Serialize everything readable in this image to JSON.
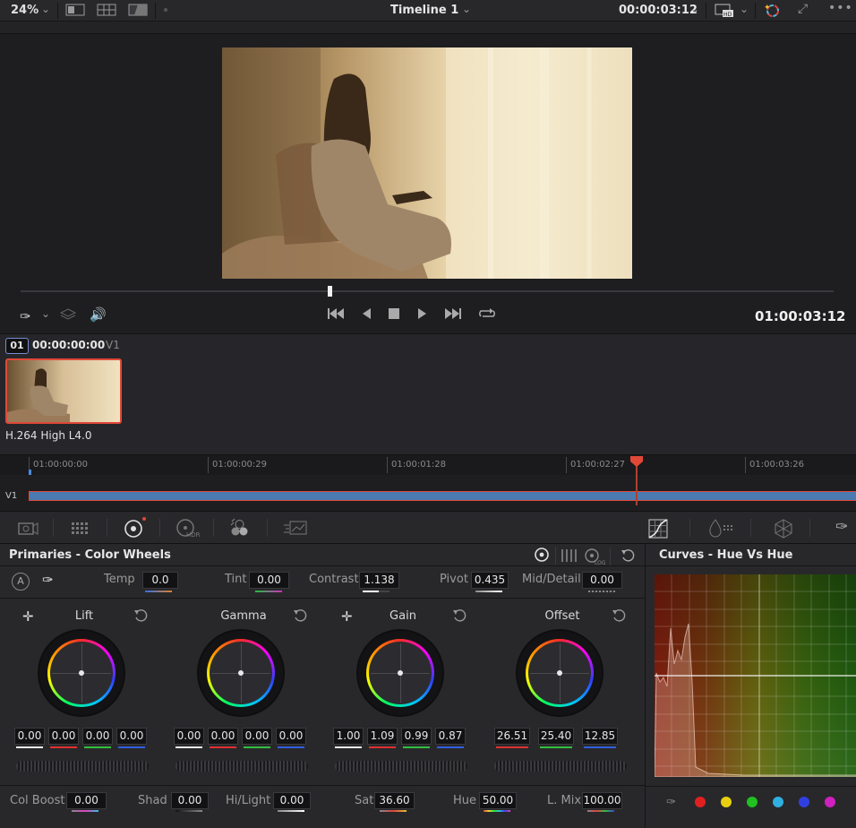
{
  "topbar": {
    "zoom": "24%",
    "timeline_name": "Timeline 1",
    "timecode": "00:00:03:12"
  },
  "viewer": {
    "timecode": "01:00:03:12"
  },
  "clip": {
    "index": "01",
    "timecode": "00:00:00:00",
    "track": "V1",
    "codec": "H.264 High L4.0"
  },
  "timeline": {
    "ticks": [
      "01:00:00:00",
      "01:00:00:29",
      "01:00:01:28",
      "01:00:02:27",
      "01:00:03:26"
    ],
    "track": "V1",
    "playhead_fraction": 0.744
  },
  "primaries": {
    "title": "Primaries - Color Wheels",
    "temp_label": "Temp",
    "temp": "0.0",
    "tint_label": "Tint",
    "tint": "0.00",
    "contrast_label": "Contrast",
    "contrast": "1.138",
    "pivot_label": "Pivot",
    "pivot": "0.435",
    "middetail_label": "Mid/Detail",
    "middetail": "0.00",
    "wheels": [
      {
        "name": "Lift",
        "values": [
          "0.00",
          "0.00",
          "0.00",
          "0.00"
        ]
      },
      {
        "name": "Gamma",
        "values": [
          "0.00",
          "0.00",
          "0.00",
          "0.00"
        ]
      },
      {
        "name": "Gain",
        "values": [
          "1.00",
          "1.09",
          "0.99",
          "0.87"
        ]
      },
      {
        "name": "Offset",
        "values": [
          "26.51",
          "25.40",
          "12.85"
        ]
      }
    ],
    "colboost_label": "Col Boost",
    "colboost": "0.00",
    "shad_label": "Shad",
    "shad": "0.00",
    "hilight_label": "Hi/Light",
    "hilight": "0.00",
    "sat_label": "Sat",
    "sat": "36.60",
    "hue_label": "Hue",
    "hue": "50.00",
    "lmix_label": "L. Mix",
    "lmix": "100.00"
  },
  "curves": {
    "title": "Curves - Hue Vs Hue",
    "swatches": [
      "#e02020",
      "#e8d010",
      "#20c020",
      "#30b0e0",
      "#3040e0",
      "#d020c0"
    ]
  },
  "colors": {
    "accent_red": "#e04838",
    "clip_track": "#4a7ab0"
  }
}
